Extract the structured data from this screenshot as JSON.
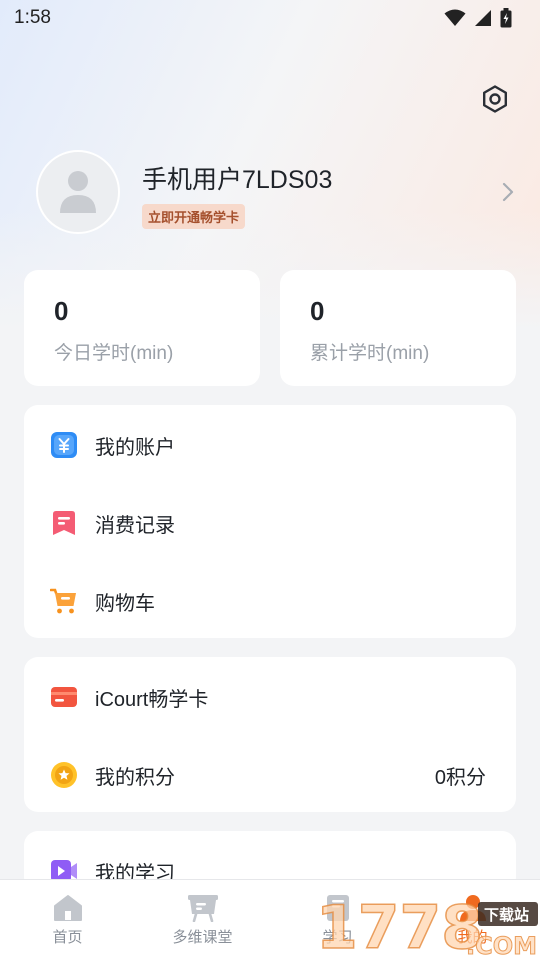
{
  "status_bar": {
    "time": "1:58"
  },
  "profile": {
    "username": "手机用户7LDS03",
    "vip_badge": "立即开通畅学卡"
  },
  "stats": [
    {
      "value": "0",
      "label": "今日学时(min)"
    },
    {
      "value": "0",
      "label": "累计学时(min)"
    }
  ],
  "menu_group_1": [
    {
      "label": "我的账户",
      "icon": "wallet-icon"
    },
    {
      "label": "消费记录",
      "icon": "receipt-icon"
    },
    {
      "label": "购物车",
      "icon": "cart-icon"
    }
  ],
  "menu_group_2": [
    {
      "label": "iCourt畅学卡",
      "icon": "card-icon"
    },
    {
      "label": "我的积分",
      "icon": "points-icon",
      "value": "0积分"
    }
  ],
  "menu_group_3": [
    {
      "label": "我的学习",
      "icon": "video-icon"
    }
  ],
  "tabbar": [
    {
      "label": "首页",
      "icon": "home-icon"
    },
    {
      "label": "多维课堂",
      "icon": "classroom-icon"
    },
    {
      "label": "学习",
      "icon": "study-icon"
    },
    {
      "label": "我的",
      "icon": "profile-icon",
      "active": true
    }
  ],
  "watermark": {
    "brand": "1778",
    "sub": "下载站",
    "domain": ".COM"
  },
  "colors": {
    "accent": "#f06a1f",
    "card_bg": "#ffffff",
    "page_bg": "#f3f4f6",
    "muted_text": "#9aa0a8"
  }
}
